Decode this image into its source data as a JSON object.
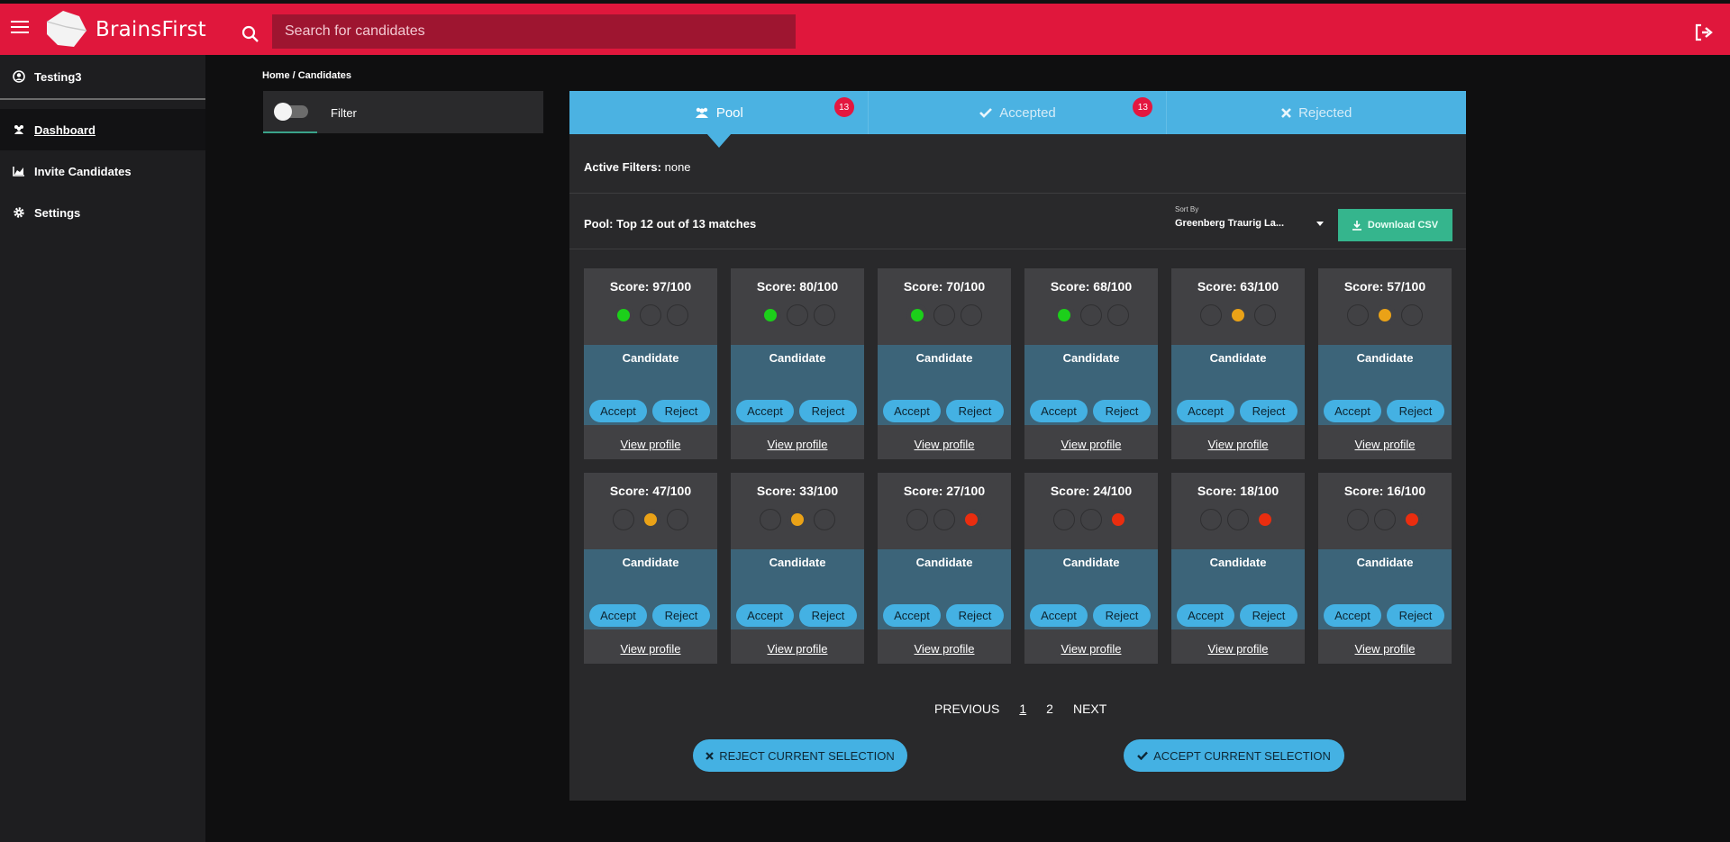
{
  "header": {
    "brand": "BrainsFirst",
    "search_placeholder": "Search for candidates"
  },
  "sidebar": {
    "user": "Testing3",
    "items": [
      {
        "label": "Dashboard",
        "icon": "users-icon",
        "active": true
      },
      {
        "label": "Invite Candidates",
        "icon": "chart-icon",
        "active": false
      },
      {
        "label": "Settings",
        "icon": "gear-icon",
        "active": false
      }
    ]
  },
  "breadcrumb": "Home / Candidates",
  "filter": {
    "label": "Filter",
    "enabled": false
  },
  "tabs": [
    {
      "label": "Pool",
      "icon": "users-icon",
      "badge": "13",
      "active": true
    },
    {
      "label": "Accepted",
      "icon": "check-icon",
      "badge": "13",
      "active": false
    },
    {
      "label": "Rejected",
      "icon": "times-icon",
      "badge": null,
      "active": false
    }
  ],
  "active_filters": {
    "label": "Active Filters:",
    "value": "none"
  },
  "pool_summary": "Pool: Top 12 out of 13 matches",
  "sort": {
    "label": "Sort By",
    "value": "Greenberg Traurig La..."
  },
  "download_label": "Download CSV",
  "cards": [
    {
      "score": "Score: 97/100",
      "level": 0,
      "name": "Candidate"
    },
    {
      "score": "Score: 80/100",
      "level": 0,
      "name": "Candidate"
    },
    {
      "score": "Score: 70/100",
      "level": 0,
      "name": "Candidate"
    },
    {
      "score": "Score: 68/100",
      "level": 0,
      "name": "Candidate"
    },
    {
      "score": "Score: 63/100",
      "level": 1,
      "name": "Candidate"
    },
    {
      "score": "Score: 57/100",
      "level": 1,
      "name": "Candidate"
    },
    {
      "score": "Score: 47/100",
      "level": 1,
      "name": "Candidate"
    },
    {
      "score": "Score: 33/100",
      "level": 1,
      "name": "Candidate"
    },
    {
      "score": "Score: 27/100",
      "level": 2,
      "name": "Candidate"
    },
    {
      "score": "Score: 24/100",
      "level": 2,
      "name": "Candidate"
    },
    {
      "score": "Score: 18/100",
      "level": 2,
      "name": "Candidate"
    },
    {
      "score": "Score: 16/100",
      "level": 2,
      "name": "Candidate"
    }
  ],
  "card_actions": {
    "accept": "Accept",
    "reject": "Reject",
    "view": "View profile"
  },
  "pagination": {
    "previous": "PREVIOUS",
    "pages": [
      "1",
      "2"
    ],
    "current": "1",
    "next": "NEXT"
  },
  "bulk": {
    "reject": "REJECT CURRENT SELECTION",
    "accept": "ACCEPT CURRENT SELECTION"
  },
  "colors": {
    "brand": "#e0173c",
    "tab": "#4bb2e2",
    "green": "#1ccf1a",
    "orange": "#eaa217",
    "red": "#ea2d0f",
    "download": "#35b58d"
  }
}
